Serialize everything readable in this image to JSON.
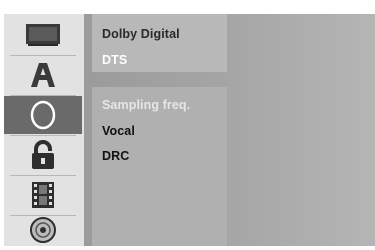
{
  "sidebar": {
    "items": [
      {
        "icon": "display-icon",
        "selected": false
      },
      {
        "icon": "language-letter-icon",
        "selected": false
      },
      {
        "icon": "audio-circle-icon",
        "selected": true
      },
      {
        "icon": "padlock-icon",
        "selected": false
      },
      {
        "icon": "film-strip-icon",
        "selected": false
      },
      {
        "icon": "disc-icon",
        "selected": false
      }
    ]
  },
  "menu": {
    "top": [
      "Dolby Digital",
      "DTS"
    ],
    "bottom": [
      "Sampling freq.",
      "Vocal",
      "DRC"
    ]
  },
  "colors": {
    "selected_bg": "#6a6a6a",
    "panel": "#a4a4a4"
  }
}
